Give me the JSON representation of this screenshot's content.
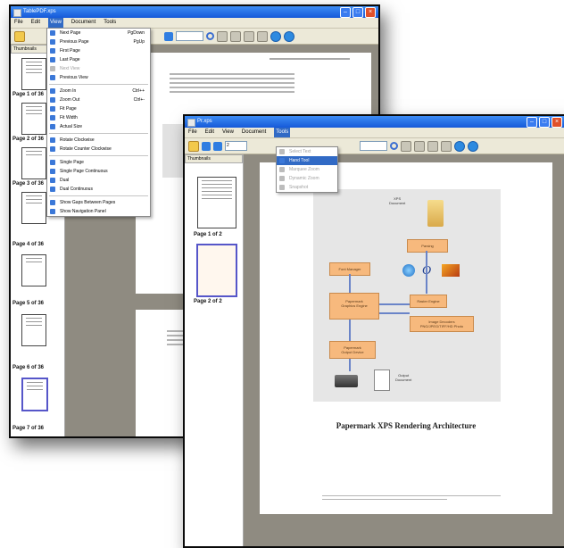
{
  "back_window": {
    "title": "TablePDF.xps",
    "menu": [
      "File",
      "Edit",
      "View",
      "Document",
      "Tools"
    ],
    "active_menu": "View",
    "thumbnails_tab": "Thumbnails",
    "page_labels": [
      "Page 1 of 36",
      "Page 2 of 36",
      "Page 3 of 36",
      "Page 4 of 36",
      "Page 5 of 36",
      "Page 6 of 36",
      "Page 7 of 36"
    ],
    "view_menu": {
      "items": [
        {
          "label": "Next Page",
          "shortcut": "PgDown",
          "dim": false
        },
        {
          "label": "Previous Page",
          "shortcut": "PgUp",
          "dim": false
        },
        {
          "label": "First Page",
          "shortcut": "",
          "dim": false
        },
        {
          "label": "Last Page",
          "shortcut": "",
          "dim": false
        },
        {
          "label": "Next View",
          "shortcut": "",
          "dim": true
        },
        {
          "label": "Previous View",
          "shortcut": "",
          "dim": false
        },
        {
          "sep": true
        },
        {
          "label": "Zoom In",
          "shortcut": "Ctrl++",
          "dim": false
        },
        {
          "label": "Zoom Out",
          "shortcut": "Ctrl+-",
          "dim": false
        },
        {
          "label": "Fit Page",
          "shortcut": "",
          "dim": false
        },
        {
          "label": "Fit Width",
          "shortcut": "",
          "dim": false
        },
        {
          "label": "Actual Size",
          "shortcut": "",
          "dim": false
        },
        {
          "sep": true
        },
        {
          "label": "Rotate Clockwise",
          "shortcut": "",
          "dim": false
        },
        {
          "label": "Rotate Counter Clockwise",
          "shortcut": "",
          "dim": false
        },
        {
          "sep": true
        },
        {
          "label": "Single Page",
          "shortcut": "",
          "dim": false
        },
        {
          "label": "Single Page Continuous",
          "shortcut": "",
          "dim": false
        },
        {
          "label": "Dual",
          "shortcut": "",
          "dim": false
        },
        {
          "label": "Dual Continuous",
          "shortcut": "",
          "dim": false
        },
        {
          "sep": true
        },
        {
          "label": "Show Gaps Between Pages",
          "shortcut": "",
          "dim": false
        },
        {
          "label": "Show Navigation Panel",
          "shortcut": "",
          "dim": false
        }
      ]
    }
  },
  "front_window": {
    "title": "Pr.xps",
    "menu": [
      "File",
      "Edit",
      "View",
      "Document",
      "Tools"
    ],
    "active_menu": "Tools",
    "page_input": "2",
    "thumbnails_tab": "Thumbnails",
    "page_labels": [
      "Page 1 of 2",
      "Page 2 of 2"
    ],
    "tools_menu": {
      "items": [
        {
          "label": "Select Text",
          "dim": true,
          "highlight": false
        },
        {
          "label": "Hand Tool",
          "dim": false,
          "highlight": true
        },
        {
          "label": "Marquee Zoom",
          "dim": true,
          "highlight": false
        },
        {
          "label": "Dynamic Zoom",
          "dim": true,
          "highlight": false
        },
        {
          "label": "Snapshot",
          "dim": true,
          "highlight": false
        }
      ]
    },
    "document": {
      "diagram": {
        "xps_label": [
          "XPS",
          "Document"
        ],
        "parsing": "Parsing",
        "font_manager": "Font Manager",
        "papermark_graphics": [
          "Papermark",
          "Graphics Engine"
        ],
        "raster_engine": "Raster Engine",
        "image_decoders": [
          "Image Decoders",
          "PNG/JPEG/TIFF/HD Photo"
        ],
        "papermark_device": [
          "Papermark",
          "Output Device"
        ],
        "output_label": [
          "Output",
          "Document"
        ]
      },
      "caption": "Papermark XPS Rendering Architecture"
    }
  }
}
